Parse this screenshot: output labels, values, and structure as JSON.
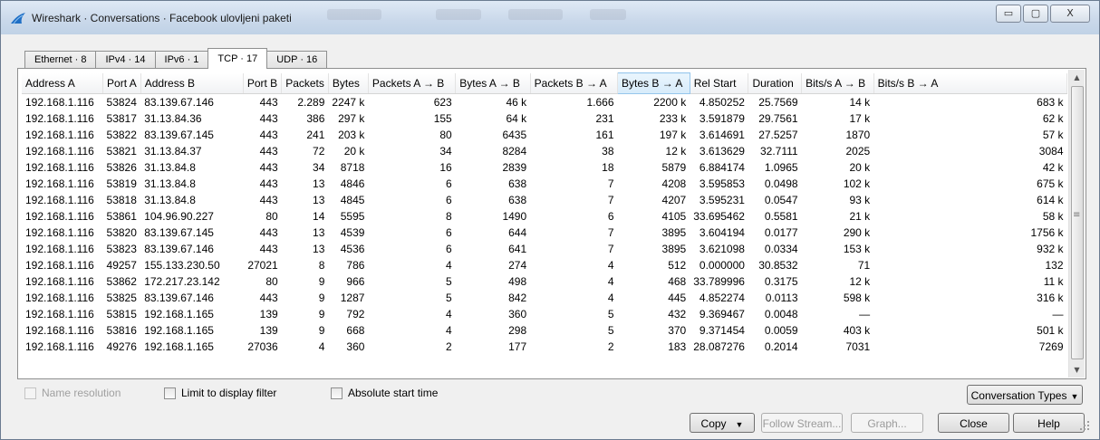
{
  "window": {
    "title": "Wireshark · Conversations · Facebook ulovljeni paketi",
    "caption_buttons": {
      "minimize": "▭",
      "maximize": "▢",
      "close": "X"
    }
  },
  "tabs": [
    {
      "label": "Ethernet · 8"
    },
    {
      "label": "IPv4 · 14"
    },
    {
      "label": "IPv6 · 1"
    },
    {
      "label": "TCP · 17"
    },
    {
      "label": "UDP · 16"
    }
  ],
  "table": {
    "columns": [
      "Address A",
      "Port A",
      "Address B",
      "Port B",
      "Packets",
      "Bytes",
      "Packets A → B",
      "Bytes A → B",
      "Packets B → A",
      "Bytes B → A",
      "Rel Start",
      "Duration",
      "Bits/s A → B",
      "Bits/s B → A"
    ],
    "rows": [
      [
        "192.168.1.116",
        "53824",
        "83.139.67.146",
        "443",
        "2.289",
        "2247 k",
        "623",
        "46 k",
        "1.666",
        "2200 k",
        "4.850252",
        "25.7569",
        "14 k",
        "683 k"
      ],
      [
        "192.168.1.116",
        "53817",
        "31.13.84.36",
        "443",
        "386",
        "297 k",
        "155",
        "64 k",
        "231",
        "233 k",
        "3.591879",
        "29.7561",
        "17 k",
        "62 k"
      ],
      [
        "192.168.1.116",
        "53822",
        "83.139.67.145",
        "443",
        "241",
        "203 k",
        "80",
        "6435",
        "161",
        "197 k",
        "3.614691",
        "27.5257",
        "1870",
        "57 k"
      ],
      [
        "192.168.1.116",
        "53821",
        "31.13.84.37",
        "443",
        "72",
        "20 k",
        "34",
        "8284",
        "38",
        "12 k",
        "3.613629",
        "32.7111",
        "2025",
        "3084"
      ],
      [
        "192.168.1.116",
        "53826",
        "31.13.84.8",
        "443",
        "34",
        "8718",
        "16",
        "2839",
        "18",
        "5879",
        "6.884174",
        "1.0965",
        "20 k",
        "42 k"
      ],
      [
        "192.168.1.116",
        "53819",
        "31.13.84.8",
        "443",
        "13",
        "4846",
        "6",
        "638",
        "7",
        "4208",
        "3.595853",
        "0.0498",
        "102 k",
        "675 k"
      ],
      [
        "192.168.1.116",
        "53818",
        "31.13.84.8",
        "443",
        "13",
        "4845",
        "6",
        "638",
        "7",
        "4207",
        "3.595231",
        "0.0547",
        "93 k",
        "614 k"
      ],
      [
        "192.168.1.116",
        "53861",
        "104.96.90.227",
        "80",
        "14",
        "5595",
        "8",
        "1490",
        "6",
        "4105",
        "33.695462",
        "0.5581",
        "21 k",
        "58 k"
      ],
      [
        "192.168.1.116",
        "53820",
        "83.139.67.145",
        "443",
        "13",
        "4539",
        "6",
        "644",
        "7",
        "3895",
        "3.604194",
        "0.0177",
        "290 k",
        "1756 k"
      ],
      [
        "192.168.1.116",
        "53823",
        "83.139.67.146",
        "443",
        "13",
        "4536",
        "6",
        "641",
        "7",
        "3895",
        "3.621098",
        "0.0334",
        "153 k",
        "932 k"
      ],
      [
        "192.168.1.116",
        "49257",
        "155.133.230.50",
        "27021",
        "8",
        "786",
        "4",
        "274",
        "4",
        "512",
        "0.000000",
        "30.8532",
        "71",
        "132"
      ],
      [
        "192.168.1.116",
        "53862",
        "172.217.23.142",
        "80",
        "9",
        "966",
        "5",
        "498",
        "4",
        "468",
        "33.789996",
        "0.3175",
        "12 k",
        "11 k"
      ],
      [
        "192.168.1.116",
        "53825",
        "83.139.67.146",
        "443",
        "9",
        "1287",
        "5",
        "842",
        "4",
        "445",
        "4.852274",
        "0.0113",
        "598 k",
        "316 k"
      ],
      [
        "192.168.1.116",
        "53815",
        "192.168.1.165",
        "139",
        "9",
        "792",
        "4",
        "360",
        "5",
        "432",
        "9.369467",
        "0.0048",
        "—",
        "—"
      ],
      [
        "192.168.1.116",
        "53816",
        "192.168.1.165",
        "139",
        "9",
        "668",
        "4",
        "298",
        "5",
        "370",
        "9.371454",
        "0.0059",
        "403 k",
        "501 k"
      ],
      [
        "192.168.1.116",
        "49276",
        "192.168.1.165",
        "27036",
        "4",
        "360",
        "2",
        "177",
        "2",
        "183",
        "28.087276",
        "0.2014",
        "7031",
        "7269"
      ]
    ]
  },
  "options": {
    "name_resolution": "Name resolution",
    "limit_to_display_filter": "Limit to display filter",
    "absolute_start_time": "Absolute start time"
  },
  "buttons": {
    "conversation_types": "Conversation Types",
    "copy": "Copy",
    "follow_stream": "Follow Stream...",
    "graph": "Graph...",
    "close": "Close",
    "help": "Help"
  }
}
